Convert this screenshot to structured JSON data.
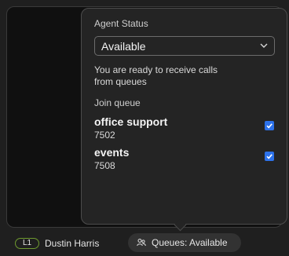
{
  "agent_status": {
    "heading": "Agent Status",
    "selected": "Available",
    "description": "You are ready to receive calls from queues"
  },
  "join_queue": {
    "heading": "Join queue",
    "queues": [
      {
        "name": "office support",
        "number": "7502",
        "checked": true
      },
      {
        "name": "events",
        "number": "7508",
        "checked": true
      }
    ]
  },
  "status_bar": {
    "line_badge": "L1",
    "user_name": "Dustin Harris",
    "queues_button_label": "Queues: Available"
  },
  "colors": {
    "checkbox_accent": "#2d72ea",
    "line_badge_border": "#6f9a2f"
  },
  "icons": {
    "select_chevron": "chevron-down-icon",
    "checkbox": "checkmark-icon",
    "queues": "queue-people-icon"
  }
}
